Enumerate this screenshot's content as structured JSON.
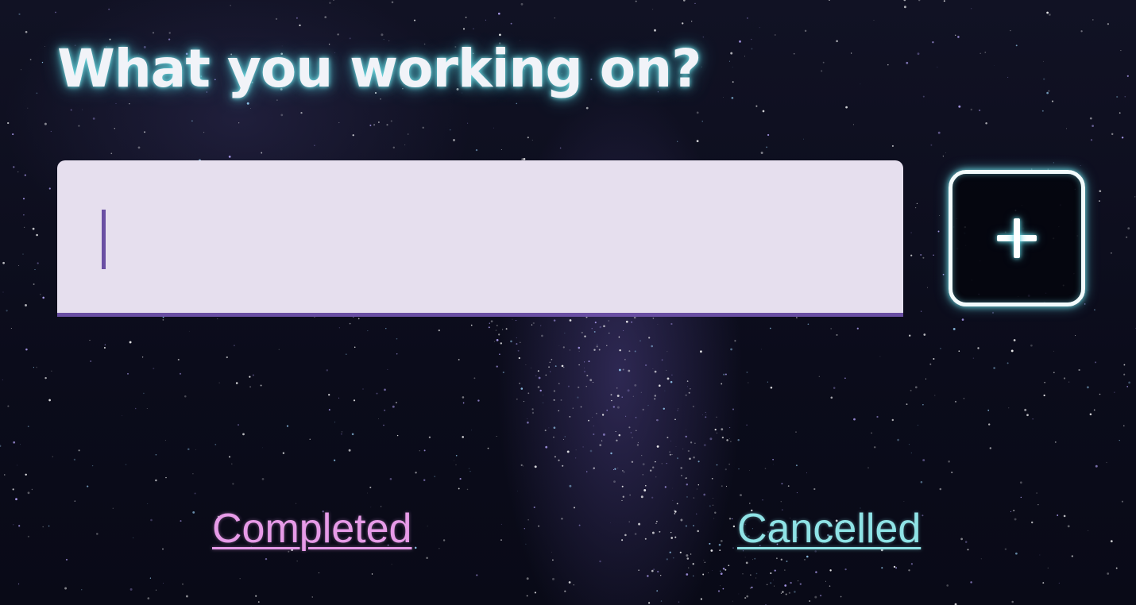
{
  "header": {
    "title": "What you working on?"
  },
  "task_form": {
    "input_value": "",
    "input_placeholder": "",
    "add_button_icon": "plus-icon"
  },
  "footer_links": {
    "completed": "Completed",
    "cancelled": "Cancelled"
  },
  "colors": {
    "input_background": "#e6dfee",
    "input_underline": "#6a4fa3",
    "title_glow": "#5ad2dc",
    "completed_link": "#e79be8",
    "cancelled_link": "#8fe3e6",
    "background": "#0a0b1a"
  }
}
